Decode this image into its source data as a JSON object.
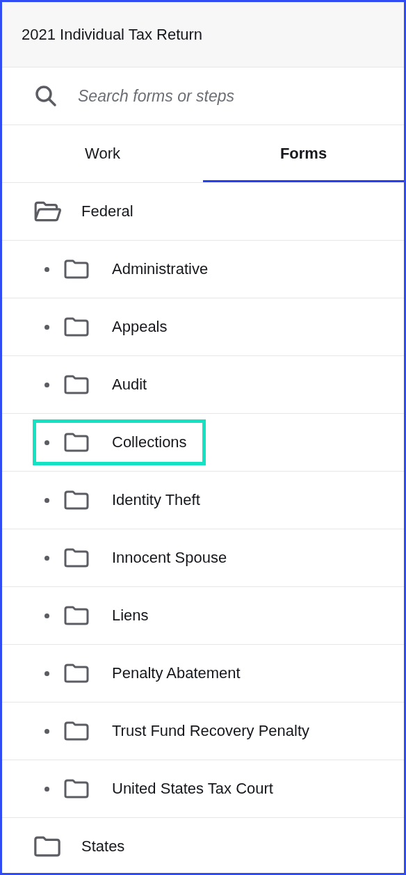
{
  "header": {
    "title": "2021 Individual Tax Return"
  },
  "search": {
    "placeholder": "Search forms or steps"
  },
  "tabs": [
    {
      "label": "Work",
      "selected": false
    },
    {
      "label": "Forms",
      "selected": true
    }
  ],
  "tree": [
    {
      "label": "Federal",
      "expanded": true,
      "children": [
        {
          "label": "Administrative",
          "highlighted": false
        },
        {
          "label": "Appeals",
          "highlighted": false
        },
        {
          "label": "Audit",
          "highlighted": false
        },
        {
          "label": "Collections",
          "highlighted": true
        },
        {
          "label": "Identity Theft",
          "highlighted": false
        },
        {
          "label": "Innocent Spouse",
          "highlighted": false
        },
        {
          "label": "Liens",
          "highlighted": false
        },
        {
          "label": "Penalty Abatement",
          "highlighted": false
        },
        {
          "label": "Trust Fund Recovery Penalty",
          "highlighted": false
        },
        {
          "label": "United States Tax Court",
          "highlighted": false
        }
      ]
    },
    {
      "label": "States",
      "expanded": false
    }
  ]
}
